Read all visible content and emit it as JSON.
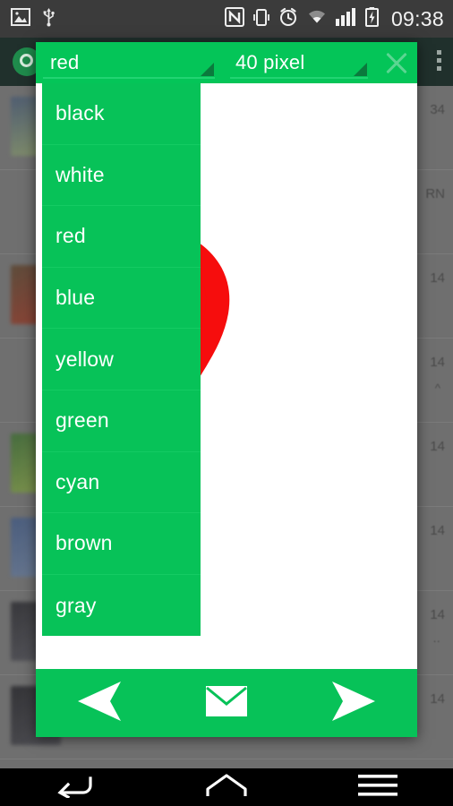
{
  "status_bar": {
    "time": "09:38",
    "icons": [
      "image-icon",
      "usb-icon",
      "nfc-icon",
      "vibrate-icon",
      "alarm-icon",
      "wifi-icon",
      "signal-icon",
      "battery-charging-icon"
    ]
  },
  "background_app": {
    "name": "whatsapp",
    "appbar": {
      "logo": "whatsapp-logo",
      "overflow": "overflow-menu-icon"
    },
    "rows": [
      {
        "date": "34",
        "sub": ""
      },
      {
        "date": "RN",
        "sub": ""
      },
      {
        "date": "14",
        "sub": ""
      },
      {
        "date": "14",
        "sub": "^"
      },
      {
        "date": "14",
        "sub": ""
      },
      {
        "date": "14",
        "sub": ""
      },
      {
        "date": "14",
        "sub": "··"
      },
      {
        "date": "14",
        "sub": ""
      }
    ]
  },
  "dialog": {
    "header": {
      "color_spinner": {
        "value": "red",
        "indicator": "spinner-triangle-icon"
      },
      "size_spinner": {
        "value": "40 pixel",
        "indicator": "spinner-triangle-icon"
      },
      "close": {
        "icon": "close-icon",
        "label": ""
      }
    },
    "dropdown": {
      "open": true,
      "selected": "red",
      "options": [
        "black",
        "white",
        "red",
        "blue",
        "yellow",
        "green",
        "cyan",
        "brown",
        "gray"
      ]
    },
    "canvas": {
      "stroke_color": "#f60d0d",
      "stroke_width_label": "40 pixel",
      "drawing": "heart-shape"
    },
    "toolbar": {
      "buttons": [
        {
          "name": "back-button",
          "icon": "triangle-left-icon"
        },
        {
          "name": "mail-button",
          "icon": "envelope-icon"
        },
        {
          "name": "send-button",
          "icon": "send-arrow-icon"
        }
      ]
    }
  },
  "nav_bar": {
    "buttons": [
      {
        "name": "android-back-button",
        "icon": "back-arrow-icon"
      },
      {
        "name": "android-home-button",
        "icon": "home-icon"
      },
      {
        "name": "android-recents-button",
        "icon": "menu-icon"
      }
    ]
  },
  "colors": {
    "accent_green": "#07c258",
    "header_green": "#04c558",
    "stroke_red": "#f60d0d",
    "status_bar": "#3b3b3b",
    "nav_bar": "#000000"
  }
}
